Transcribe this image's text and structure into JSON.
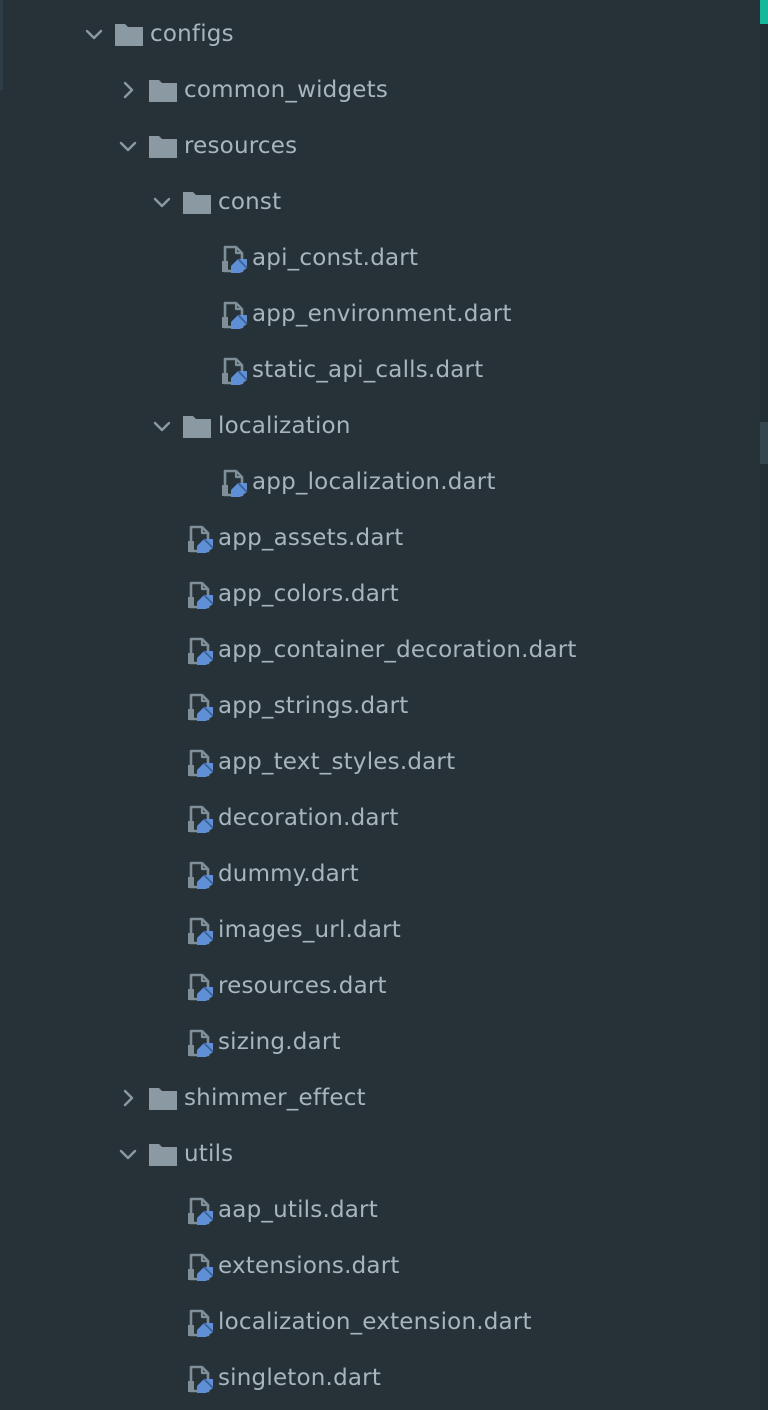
{
  "colors": {
    "background": "#263238",
    "text": "#a7b5bd",
    "folder_icon": "#8a99a2",
    "dart_file_icon": "#7f8f99",
    "dart_badge": "#5f8fd6",
    "scroll_accent": "#15b89a"
  },
  "tree": [
    {
      "id": "configs",
      "label": "configs",
      "type": "folder",
      "level": 0,
      "state": "expanded"
    },
    {
      "id": "common-widgets",
      "label": "common_widgets",
      "type": "folder",
      "level": 1,
      "state": "collapsed"
    },
    {
      "id": "resources",
      "label": "resources",
      "type": "folder",
      "level": 1,
      "state": "expanded"
    },
    {
      "id": "const",
      "label": "const",
      "type": "folder",
      "level": 2,
      "state": "expanded"
    },
    {
      "id": "api-const",
      "label": "api_const.dart",
      "type": "file",
      "level": 3
    },
    {
      "id": "app-environment",
      "label": "app_environment.dart",
      "type": "file",
      "level": 3
    },
    {
      "id": "static-api-calls",
      "label": "static_api_calls.dart",
      "type": "file",
      "level": 3
    },
    {
      "id": "localization",
      "label": "localization",
      "type": "folder",
      "level": 2,
      "state": "expanded"
    },
    {
      "id": "app-localization",
      "label": "app_localization.dart",
      "type": "file",
      "level": 3
    },
    {
      "id": "app-assets",
      "label": "app_assets.dart",
      "type": "file",
      "level": 2
    },
    {
      "id": "app-colors",
      "label": "app_colors.dart",
      "type": "file",
      "level": 2
    },
    {
      "id": "app-container-decoration",
      "label": "app_container_decoration.dart",
      "type": "file",
      "level": 2
    },
    {
      "id": "app-strings",
      "label": "app_strings.dart",
      "type": "file",
      "level": 2
    },
    {
      "id": "app-text-styles",
      "label": "app_text_styles.dart",
      "type": "file",
      "level": 2
    },
    {
      "id": "decoration",
      "label": "decoration.dart",
      "type": "file",
      "level": 2
    },
    {
      "id": "dummy",
      "label": "dummy.dart",
      "type": "file",
      "level": 2
    },
    {
      "id": "images-url",
      "label": "images_url.dart",
      "type": "file",
      "level": 2
    },
    {
      "id": "resources-dart",
      "label": "resources.dart",
      "type": "file",
      "level": 2
    },
    {
      "id": "sizing",
      "label": "sizing.dart",
      "type": "file",
      "level": 2
    },
    {
      "id": "shimmer-effect",
      "label": "shimmer_effect",
      "type": "folder",
      "level": 1,
      "state": "collapsed"
    },
    {
      "id": "utils",
      "label": "utils",
      "type": "folder",
      "level": 1,
      "state": "expanded"
    },
    {
      "id": "aap-utils",
      "label": "aap_utils.dart",
      "type": "file",
      "level": 2
    },
    {
      "id": "extensions",
      "label": "extensions.dart",
      "type": "file",
      "level": 2
    },
    {
      "id": "localization-extension",
      "label": "localization_extension.dart",
      "type": "file",
      "level": 2
    },
    {
      "id": "singleton",
      "label": "singleton.dart",
      "type": "file",
      "level": 2
    }
  ]
}
